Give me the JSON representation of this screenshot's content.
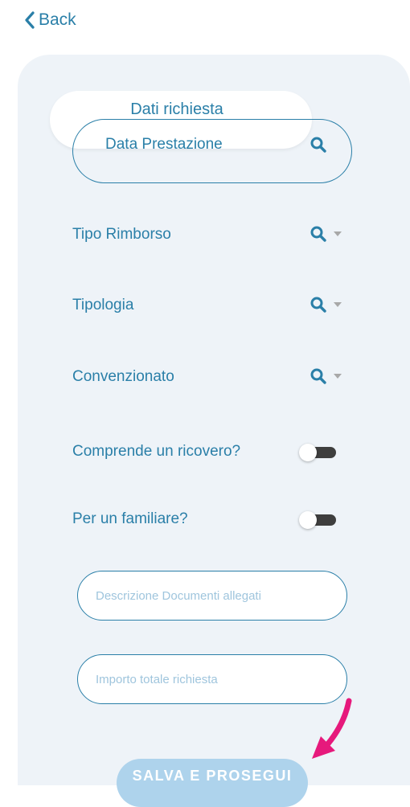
{
  "header": {
    "back_label": "Back"
  },
  "tab": {
    "label": "Dati richiesta"
  },
  "date_field": {
    "label": "Data Prestazione"
  },
  "selects": [
    {
      "label": "Tipo Rimborso"
    },
    {
      "label": "Tipologia"
    },
    {
      "label": "Convenzionato"
    }
  ],
  "toggles": [
    {
      "label": "Comprende un ricovero?",
      "checked": false
    },
    {
      "label": "Per un familiare?",
      "checked": false
    }
  ],
  "inputs": {
    "description_placeholder": "Descrizione Documenti allegati",
    "amount_placeholder": "Importo totale richiesta"
  },
  "save_button": {
    "label": "SALVA E PROSEGUI"
  },
  "colors": {
    "accent": "#2a7fa8",
    "panel_bg": "#eef3f8",
    "button_bg": "#aed3ec",
    "annotation_arrow": "#e6197c"
  }
}
